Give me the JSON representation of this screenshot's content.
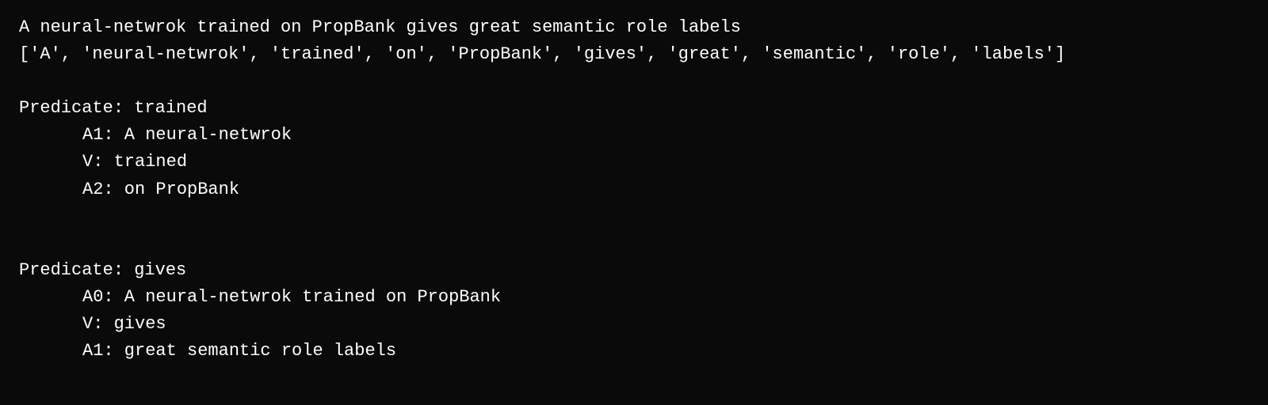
{
  "content": {
    "sentence": "A neural-netwrok trained on PropBank gives great semantic role labels",
    "tokens": "['A', 'neural-netwrok', 'trained', 'on', 'PropBank', 'gives', 'great', 'semantic', 'role', 'labels']",
    "predicate1": {
      "label": "Predicate: trained",
      "roles": [
        "A1: A neural-netwrok",
        "V: trained",
        "A2: on PropBank"
      ]
    },
    "predicate2": {
      "label": "Predicate: gives",
      "roles": [
        "A0: A neural-netwrok trained on PropBank",
        "V: gives",
        "A1: great semantic role labels"
      ]
    }
  }
}
